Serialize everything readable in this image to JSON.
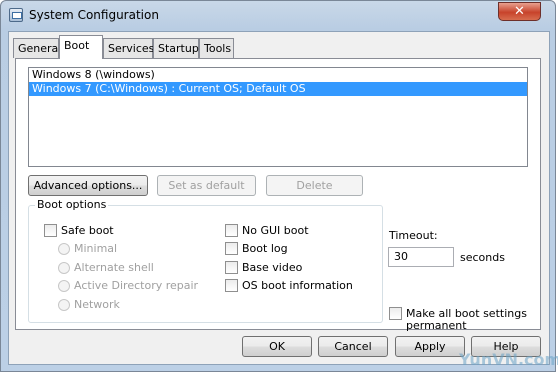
{
  "window": {
    "title": "System Configuration",
    "close_glyph": "✕"
  },
  "tabs": [
    {
      "label": "General"
    },
    {
      "label": "Boot",
      "active": true
    },
    {
      "label": "Services"
    },
    {
      "label": "Startup"
    },
    {
      "label": "Tools"
    }
  ],
  "os_list": [
    {
      "label": "Windows 8 (\\windows)",
      "selected": false
    },
    {
      "label": "Windows 7 (C:\\Windows) : Current OS; Default OS",
      "selected": true
    }
  ],
  "list_buttons": {
    "advanced": "Advanced options...",
    "set_default": "Set as default",
    "delete": "Delete"
  },
  "boot_options": {
    "title": "Boot options",
    "safe_boot": "Safe boot",
    "minimal": "Minimal",
    "alternate_shell": "Alternate shell",
    "ad_repair": "Active Directory repair",
    "network": "Network",
    "no_gui_boot": "No GUI boot",
    "boot_log": "Boot log",
    "base_video": "Base video",
    "os_boot_info": "OS boot information"
  },
  "timeout": {
    "label": "Timeout:",
    "value": "30",
    "unit": "seconds"
  },
  "permanent": {
    "line1": "Make all boot settings",
    "line2": "permanent"
  },
  "footer": {
    "ok": "OK",
    "cancel": "Cancel",
    "apply": "Apply",
    "help": "Help"
  },
  "watermark": "YunVN.com",
  "colors": {
    "selection": "#3399ff",
    "close_button": "#c7432b",
    "title_gradient": "#b9cde3"
  }
}
